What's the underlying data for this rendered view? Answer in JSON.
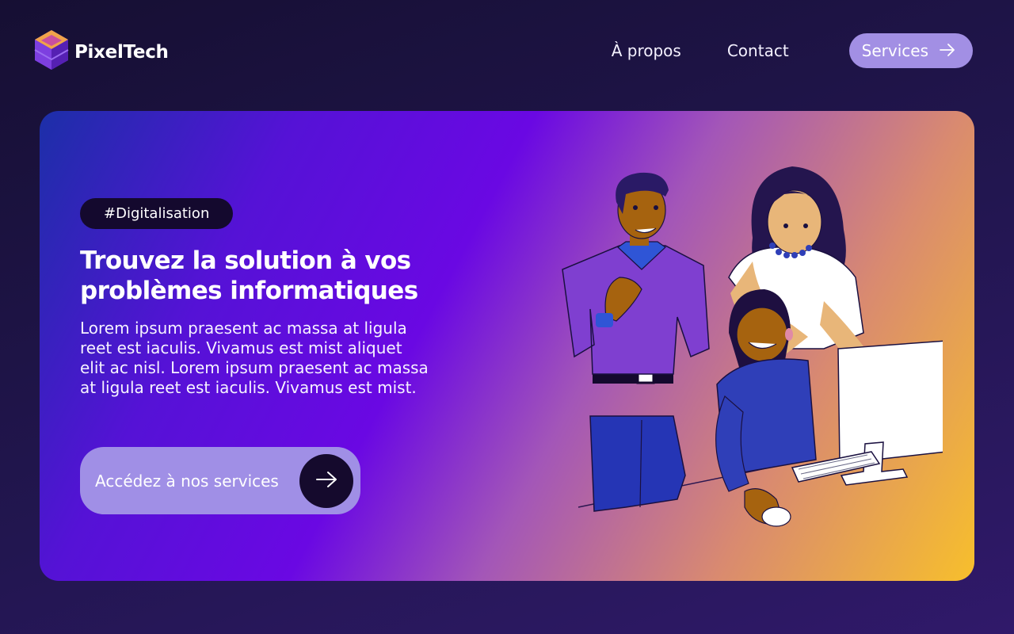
{
  "header": {
    "logo_text": "PixelTech",
    "nav": [
      {
        "label": "À propos"
      },
      {
        "label": "Contact"
      }
    ],
    "services_button": "Services"
  },
  "hero": {
    "tag": "#Digitalisation",
    "title_line1": "Trouvez la solution à vos",
    "title_line2": "problèmes informatiques",
    "description": "Lorem ipsum praesent ac massa at ligula reet est iaculis. Vivamus est mist aliquet elit ac nisl. Lorem ipsum praesent ac massa at ligula reet est iaculis. Vivamus est mist.",
    "cta_label": "Accédez à nos services"
  },
  "icons": {
    "logo": "cube-logo-icon",
    "services_arrow": "arrow-right-icon",
    "cta_arrow": "arrow-right-icon"
  },
  "colors": {
    "page_bg": "#1b1240",
    "accent_button": "#a28fe4",
    "tag_bg": "#14092e",
    "hero_gradient_start": "#1c2fa8",
    "hero_gradient_mid": "#6a08e3",
    "hero_gradient_end": "#f7bf2c"
  }
}
